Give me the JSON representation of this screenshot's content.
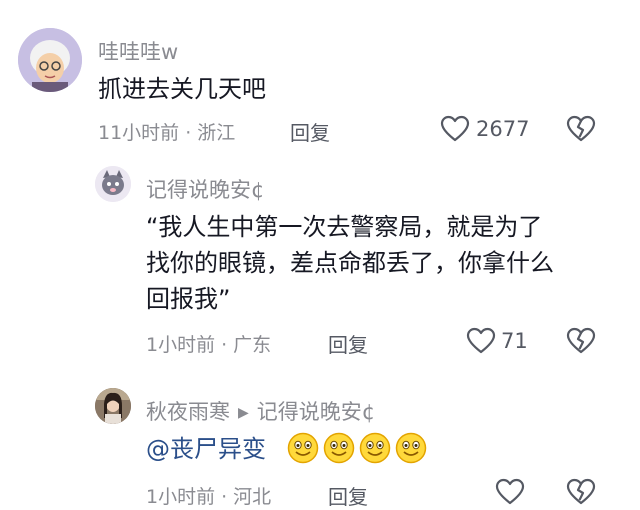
{
  "comments": [
    {
      "username": "哇哇哇w",
      "text": "抓进去关几天吧",
      "time": "11小时前",
      "location": "浙江",
      "reply_label": "回复",
      "likes": "2677",
      "avatar_icon": "old-granny-avatar"
    },
    {
      "username": "记得说晚安¢",
      "text_lines": [
        "“我人生中第一次去警察局，就是为了",
        "找你的眼镜，差点命都丢了，你拿什么",
        "回报我”"
      ],
      "time": "1小时前",
      "location": "广东",
      "reply_label": "回复",
      "likes": "71",
      "avatar_icon": "cartoon-cat-avatar"
    },
    {
      "username": "秋夜雨寒",
      "reply_to": "记得说晚安¢",
      "mention": "@丧尸异变",
      "emojis": [
        "grinning-emoji",
        "grinning-emoji",
        "grinning-emoji",
        "grinning-emoji"
      ],
      "time": "1小时前",
      "location": "河北",
      "reply_label": "回复",
      "avatar_icon": "girl-photo-avatar"
    }
  ],
  "separator": "·",
  "colors": {
    "username": "#8a8b91",
    "text": "#161823",
    "mention": "#2b4f8a"
  }
}
